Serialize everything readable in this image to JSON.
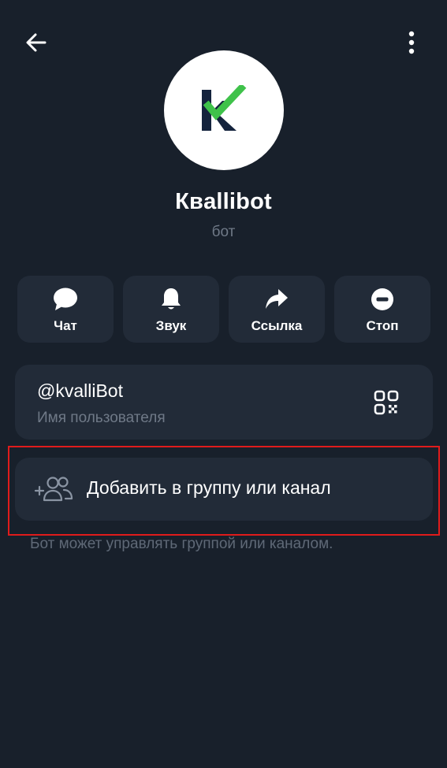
{
  "header": {
    "back_icon": "arrow-left-icon",
    "more_icon": "more-vertical-icon"
  },
  "profile": {
    "name": "Квallibot",
    "subtitle": "бот",
    "avatar_icon": "kvalli-logo"
  },
  "actions": [
    {
      "label": "Чат",
      "icon": "chat-bubble-icon"
    },
    {
      "label": "Звук",
      "icon": "bell-icon"
    },
    {
      "label": "Ссылка",
      "icon": "share-arrow-icon"
    },
    {
      "label": "Стоп",
      "icon": "stop-minus-icon"
    }
  ],
  "username_card": {
    "username": "@kvalliBot",
    "caption": "Имя пользователя",
    "qr_icon": "qr-code-icon"
  },
  "add_card": {
    "label": "Добавить в группу или канал",
    "icon": "add-people-icon"
  },
  "hint": "Бот может управлять группой или каналом.",
  "colors": {
    "background": "#18202b",
    "card": "#222b38",
    "secondary_text": "#6f7987",
    "logo_navy": "#14233d",
    "logo_green": "#3fc24a",
    "highlight": "#e01b1b"
  }
}
